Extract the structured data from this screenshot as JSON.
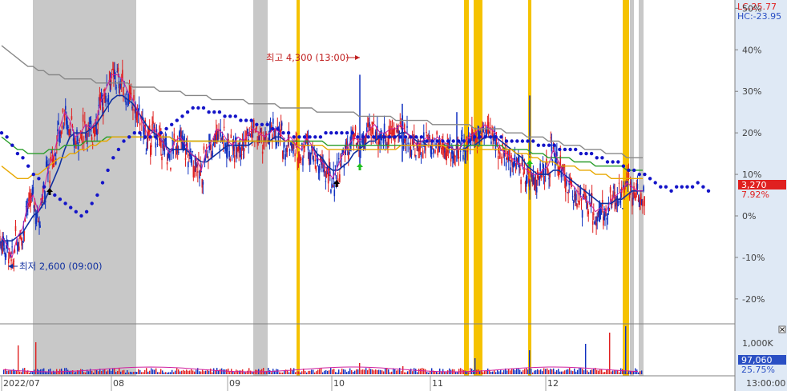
{
  "chart_data": {
    "type": "line",
    "price_panel": {
      "y_axis_percent_ticks": [
        "50%",
        "40%",
        "30%",
        "20%",
        "10%",
        "0%",
        "-10%",
        "-20%"
      ],
      "y_range_percent": [
        -26,
        52
      ],
      "lc_label": "LC:25.77",
      "hc_label": "HC:-23.95",
      "current_price_label": "3,270",
      "current_change_label": "7.92%",
      "high_annotation": "최고 4,300 (13:00)",
      "low_annotation": "최저 2,600 (09:00)",
      "series": [
        {
          "name": "price",
          "color": "#e02020",
          "values": [
            -6,
            -8,
            -11,
            -6,
            -4,
            2,
            4,
            0,
            5,
            11,
            14,
            20,
            24,
            22,
            18,
            19,
            21,
            20,
            22,
            27,
            30,
            33,
            33,
            32,
            29,
            27,
            24,
            21,
            18,
            20,
            18,
            16,
            14,
            17,
            18,
            16,
            14,
            13,
            10,
            15,
            17,
            20,
            19,
            17,
            16,
            18,
            17,
            19,
            20,
            19,
            18,
            19,
            20,
            19,
            17,
            18,
            16,
            15,
            18,
            16,
            13,
            12,
            10,
            8,
            11,
            14,
            16,
            18,
            17,
            18,
            20,
            21,
            19,
            19,
            20,
            20,
            21,
            19,
            18,
            16,
            17,
            18,
            17,
            18,
            17,
            16,
            15,
            15,
            17,
            18,
            19,
            20,
            21,
            20,
            19,
            15,
            14,
            13,
            12,
            11,
            10,
            9,
            9,
            10,
            11,
            15,
            12,
            9,
            7,
            6,
            4,
            3,
            2,
            0,
            1,
            0,
            3,
            4,
            5,
            7,
            6,
            5,
            5
          ]
        },
        {
          "name": "ma-short",
          "color": "#1030a0",
          "values": [
            -6,
            -6,
            -6,
            -5,
            -4,
            -2,
            0,
            1,
            3,
            6,
            9,
            12,
            16,
            19,
            20,
            20,
            20,
            21,
            22,
            24,
            26,
            28,
            29,
            29,
            28,
            27,
            25,
            23,
            21,
            20,
            19,
            17,
            16,
            16,
            16,
            16,
            15,
            14,
            13,
            13,
            14,
            15,
            16,
            17,
            17,
            17,
            17,
            17,
            18,
            18,
            18,
            18,
            19,
            19,
            18,
            18,
            17,
            17,
            17,
            17,
            15,
            14,
            12,
            11,
            11,
            12,
            13,
            15,
            16,
            17,
            18,
            18,
            19,
            19,
            19,
            19,
            20,
            20,
            19,
            18,
            18,
            17,
            17,
            17,
            17,
            17,
            16,
            16,
            16,
            17,
            17,
            18,
            19,
            19,
            19,
            18,
            17,
            16,
            15,
            14,
            12,
            11,
            10,
            10,
            10,
            11,
            11,
            10,
            9,
            8,
            7,
            6,
            5,
            4,
            3,
            3,
            3,
            4,
            4,
            5,
            6,
            6,
            6
          ]
        },
        {
          "name": "ma-mid",
          "color": "#2a9d2a",
          "values": [
            19,
            18,
            17,
            16,
            16,
            15,
            15,
            15,
            15,
            16,
            16,
            16,
            17,
            17,
            17,
            17,
            18,
            18,
            18,
            18,
            19,
            19,
            19,
            19,
            19,
            19,
            19,
            19,
            19,
            19,
            19,
            19,
            19,
            18,
            18,
            18,
            18,
            18,
            18,
            18,
            18,
            18,
            18,
            18,
            18,
            18,
            18,
            18,
            18,
            18,
            18,
            18,
            18,
            18,
            18,
            18,
            18,
            18,
            18,
            18,
            18,
            18,
            17,
            17,
            17,
            17,
            17,
            17,
            17,
            17,
            17,
            17,
            17,
            17,
            17,
            17,
            17,
            17,
            17,
            17,
            17,
            17,
            17,
            17,
            17,
            17,
            17,
            17,
            17,
            17,
            17,
            17,
            17,
            17,
            17,
            17,
            16,
            16,
            16,
            16,
            16,
            15,
            15,
            15,
            14,
            14,
            14,
            14,
            14,
            13,
            13,
            13,
            13,
            12,
            12,
            12,
            12,
            12,
            12,
            11,
            11,
            11,
            11
          ]
        },
        {
          "name": "ma-long",
          "color": "#e8a800",
          "values": [
            12,
            11,
            10,
            9,
            9,
            9,
            10,
            10,
            11,
            12,
            13,
            14,
            14,
            15,
            15,
            16,
            16,
            17,
            17,
            18,
            18,
            19,
            19,
            19,
            19,
            19,
            19,
            19,
            19,
            19,
            19,
            19,
            19,
            18,
            18,
            18,
            18,
            18,
            18,
            18,
            18,
            18,
            18,
            18,
            18,
            18,
            18,
            18,
            18,
            18,
            18,
            18,
            18,
            18,
            18,
            18,
            17,
            17,
            17,
            17,
            17,
            17,
            16,
            16,
            16,
            16,
            16,
            16,
            16,
            16,
            16,
            16,
            16,
            16,
            16,
            16,
            17,
            17,
            17,
            17,
            17,
            17,
            17,
            17,
            17,
            16,
            16,
            16,
            16,
            16,
            16,
            16,
            16,
            16,
            16,
            16,
            16,
            16,
            15,
            15,
            15,
            14,
            14,
            13,
            13,
            13,
            12,
            12,
            12,
            12,
            11,
            11,
            11,
            10,
            10,
            10,
            9,
            9,
            9,
            9,
            9,
            9,
            9
          ]
        },
        {
          "name": "ma-120",
          "color": "#888888",
          "values": [
            41,
            40,
            39,
            38,
            37,
            36,
            36,
            35,
            35,
            34,
            34,
            34,
            33,
            33,
            33,
            33,
            33,
            33,
            32,
            32,
            32,
            32,
            32,
            32,
            32,
            31,
            31,
            31,
            31,
            31,
            30,
            30,
            30,
            30,
            30,
            29,
            29,
            29,
            29,
            29,
            28,
            28,
            28,
            28,
            28,
            28,
            28,
            27,
            27,
            27,
            27,
            27,
            27,
            26,
            26,
            26,
            26,
            26,
            26,
            26,
            25,
            25,
            25,
            25,
            25,
            25,
            25,
            25,
            24,
            24,
            24,
            24,
            24,
            24,
            24,
            23,
            23,
            23,
            23,
            23,
            23,
            23,
            22,
            22,
            22,
            22,
            22,
            22,
            22,
            22,
            21,
            21,
            21,
            21,
            21,
            21,
            20,
            20,
            20,
            20,
            19,
            19,
            19,
            19,
            18,
            18,
            18,
            17,
            17,
            17,
            17,
            16,
            16,
            16,
            16,
            15,
            15,
            15,
            15,
            14,
            14,
            14,
            14
          ]
        }
      ],
      "dotted_series": {
        "name": "envelope",
        "color": "#1414c8",
        "values": [
          20,
          19,
          17,
          15,
          14,
          12,
          10,
          9,
          7,
          6,
          5,
          4,
          3,
          2,
          1,
          0,
          1,
          3,
          5,
          8,
          11,
          14,
          16,
          18,
          19,
          20,
          20,
          19,
          19,
          19,
          20,
          21,
          22,
          23,
          24,
          25,
          26,
          26,
          26,
          25,
          25,
          25,
          24,
          24,
          24,
          23,
          23,
          23,
          22,
          22,
          22,
          21,
          21,
          20,
          20,
          19,
          19,
          19,
          19,
          19,
          19,
          20,
          20,
          20,
          20,
          20,
          20,
          19,
          19,
          19,
          19,
          19,
          19,
          19,
          19,
          19,
          19,
          19,
          19,
          19,
          18,
          18,
          18,
          18,
          18,
          18,
          18,
          18,
          18,
          19,
          19,
          19,
          19,
          19,
          19,
          18,
          18,
          18,
          18,
          18,
          18,
          17,
          17,
          17,
          17,
          16,
          16,
          16,
          16,
          15,
          15,
          15,
          14,
          14,
          13,
          13,
          13,
          12,
          11,
          11,
          10,
          10,
          9,
          8,
          7,
          7,
          6,
          7,
          7,
          7,
          7,
          8,
          7,
          6
        ]
      }
    },
    "volume_panel": {
      "y_tick": "1,000K",
      "current_volume_label": "97,060",
      "current_ratio_label": "25.75%"
    },
    "x_tick_labels": [
      "2022/07",
      "08",
      "09",
      "10",
      "11",
      "12",
      "13:00:00"
    ],
    "bands": [
      {
        "kind": "gray",
        "color": "#c8c8c8"
      },
      {
        "kind": "gray",
        "color": "#c8c8c8"
      },
      {
        "kind": "yellow",
        "color": "#f5c200"
      },
      {
        "kind": "yellow",
        "color": "#f5c200"
      },
      {
        "kind": "yellow",
        "color": "#f5c200"
      },
      {
        "kind": "yellow",
        "color": "#f5c200"
      },
      {
        "kind": "yellow",
        "color": "#f5c200"
      },
      {
        "kind": "gray",
        "color": "#c8c8c8"
      },
      {
        "kind": "gray",
        "color": "#c8c8c8"
      }
    ],
    "grid": false,
    "legend": "none"
  }
}
